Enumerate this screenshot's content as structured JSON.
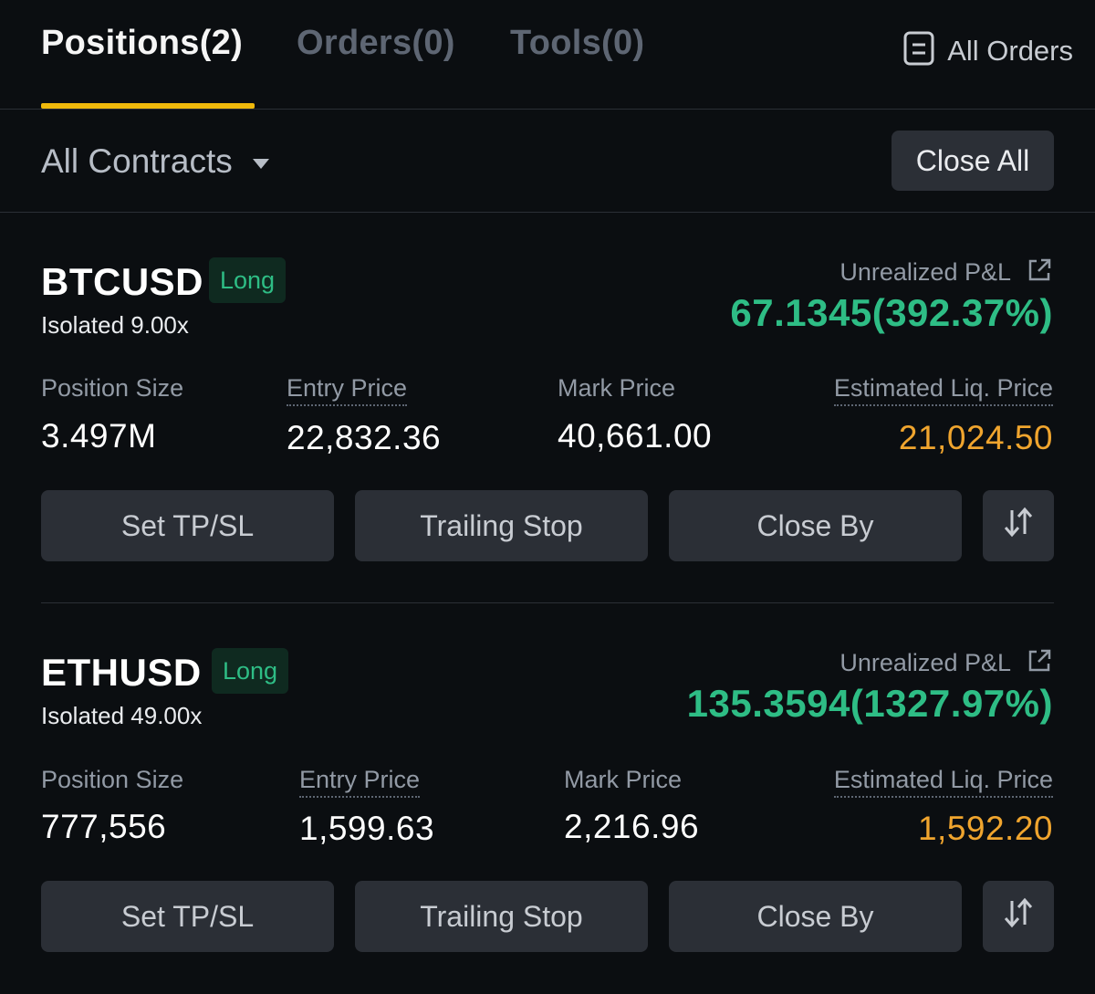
{
  "tabs": [
    {
      "label": "Positions(2)",
      "active": true
    },
    {
      "label": "Orders(0)",
      "active": false
    },
    {
      "label": "Tools(0)",
      "active": false
    }
  ],
  "header": {
    "all_orders_label": "All Orders",
    "all_orders_icon": "document-list-icon"
  },
  "filter": {
    "contracts_label": "All Contracts",
    "close_all_label": "Close All"
  },
  "colors": {
    "background": "#0b0e11",
    "accent": "#f0b90b",
    "profit": "#2ebd85",
    "liquidation": "#f0a52e",
    "button": "#2b2f36"
  },
  "positions": [
    {
      "symbol": "BTCUSD",
      "side": "Long",
      "margin_mode": "Isolated 9.00x",
      "pnl_label": "Unrealized P&L",
      "pnl_value": "67.1345(392.37%)",
      "fields": {
        "position_size_label": "Position Size",
        "position_size": "3.497M",
        "entry_price_label": "Entry Price",
        "entry_price": "22,832.36",
        "mark_price_label": "Mark Price",
        "mark_price": "40,661.00",
        "liq_price_label": "Estimated Liq. Price",
        "liq_price": "21,024.50"
      },
      "actions": {
        "tpsl": "Set TP/SL",
        "trailing": "Trailing Stop",
        "close_by": "Close By",
        "reverse_icon": "swap-arrows-icon"
      }
    },
    {
      "symbol": "ETHUSD",
      "side": "Long",
      "margin_mode": "Isolated 49.00x",
      "pnl_label": "Unrealized P&L",
      "pnl_value": "135.3594(1327.97%)",
      "fields": {
        "position_size_label": "Position Size",
        "position_size": "777,556",
        "entry_price_label": "Entry Price",
        "entry_price": "1,599.63",
        "mark_price_label": "Mark Price",
        "mark_price": "2,216.96",
        "liq_price_label": "Estimated Liq. Price",
        "liq_price": "1,592.20"
      },
      "actions": {
        "tpsl": "Set TP/SL",
        "trailing": "Trailing Stop",
        "close_by": "Close By",
        "reverse_icon": "swap-arrows-icon"
      }
    }
  ]
}
